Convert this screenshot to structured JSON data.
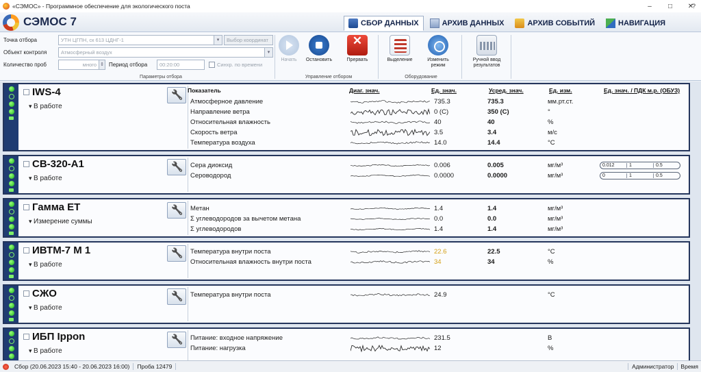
{
  "window": {
    "title": "«СЭМОС» - Программное обеспечение для экологического поста",
    "minimize": "–",
    "maximize": "□",
    "close": "✕"
  },
  "header": {
    "app_name": "СЭМОС 7",
    "tabs": [
      {
        "label": "СБОР ДАННЫХ",
        "icon": "collect-icon",
        "active": true
      },
      {
        "label": "АРХИВ ДАННЫХ",
        "icon": "archive-icon",
        "active": false
      },
      {
        "label": "АРХИВ СОБЫТИЙ",
        "icon": "events-icon",
        "active": false
      },
      {
        "label": "НАВИГАЦИЯ",
        "icon": "navigation-icon",
        "active": false
      }
    ],
    "help": "?"
  },
  "ribbon": {
    "sampling_point_label": "Точка отбора",
    "sampling_point_value": "УТН ЦГПН, ск 613 ЦДНГ-1",
    "select_coords_label": "Выбор координат",
    "control_object_label": "Объект контроля",
    "control_object_value": "Атмосферный воздух",
    "sample_count_label": "Количество проб",
    "sample_count_value": "много",
    "period_label": "Период отбора",
    "period_value": "00:20:00",
    "sync_time_label": "Синхр. по времени",
    "group_params": "Параметры отбора",
    "start_label": "Начать",
    "stop_label": "Остановить",
    "abort_label": "Прервать",
    "group_control": "Управление отбором",
    "select_label": "Выделение",
    "change_mode_label": "Изменить режим",
    "group_equipment": "Оборудование",
    "manual_input_label": "Ручной ввод результатов"
  },
  "columns": {
    "param": "Показатель",
    "diag": "Диаг. знач.",
    "value": "Ед. знач.",
    "avg": "Усред. знач.",
    "unit": "Ед. изм.",
    "pdk": "Ед. знач. / ПДК м.р. (ОБУЗ)"
  },
  "devices": [
    {
      "name": "IWS-4",
      "status": "В работе",
      "params": [
        {
          "name": "Атмосферное давление",
          "value": "735.3",
          "avg": "735.3",
          "unit": "мм.рт.ст."
        },
        {
          "name": "Направление ветра",
          "value": "0 (С)",
          "avg": "350 (С)",
          "unit": "°"
        },
        {
          "name": "Относительная влажность",
          "value": "40",
          "avg": "40",
          "unit": "%"
        },
        {
          "name": "Скорость ветра",
          "value": "3.5",
          "avg": "3.4",
          "unit": "м/с"
        },
        {
          "name": "Температура воздуха",
          "value": "14.0",
          "avg": "14.4",
          "unit": "°С"
        }
      ]
    },
    {
      "name": "СВ-320-А1",
      "status": "В работе",
      "params": [
        {
          "name": "Сера диоксид",
          "value": "0.006",
          "avg": "0.005",
          "unit": "мг/м³",
          "pdk": [
            "0.012",
            "1",
            "0.5"
          ]
        },
        {
          "name": "Сероводород",
          "value": "0.0000",
          "avg": "0.0000",
          "unit": "мг/м³",
          "pdk": [
            "0",
            "1",
            "0.5"
          ]
        }
      ]
    },
    {
      "name": "Гамма ЕТ",
      "status": "Измерение суммы",
      "params": [
        {
          "name": "Метан",
          "value": "1.4",
          "avg": "1.4",
          "unit": "мг/м³"
        },
        {
          "name": "Σ углеводородов за вычетом метана",
          "value": "0.0",
          "avg": "0.0",
          "unit": "мг/м³"
        },
        {
          "name": "Σ углеводородов",
          "value": "1.4",
          "avg": "1.4",
          "unit": "мг/м³"
        }
      ]
    },
    {
      "name": "ИВТМ-7 М 1",
      "status": "В работе",
      "params": [
        {
          "name": "Температура внутри поста",
          "value": "22.6",
          "avg": "22.5",
          "unit": "°С",
          "warn": true
        },
        {
          "name": "Относительная влажность внутри поста",
          "value": "34",
          "avg": "34",
          "unit": "%",
          "warn": true
        }
      ]
    },
    {
      "name": "СЖО",
      "status": "В работе",
      "params": [
        {
          "name": "Температура внутри поста",
          "value": "24.9",
          "avg": "",
          "unit": "°С"
        }
      ]
    },
    {
      "name": "ИБП Ippon",
      "status": "В работе",
      "params": [
        {
          "name": "Питание: входное напряжение",
          "value": "231.5",
          "avg": "",
          "unit": "В"
        },
        {
          "name": "Питание: нагрузка",
          "value": "12",
          "avg": "",
          "unit": "%"
        }
      ]
    }
  ],
  "statusbar": {
    "collection": "Сбор (20.06.2023 15:40 - 20.06.2023 16:00)",
    "sample": "Проба 12479",
    "user": "Администратор",
    "time_label": "Время"
  },
  "colors": {
    "accent": "#1f3c72",
    "border": "#24355c",
    "led_on": "#18b21a",
    "warn": "#d4a017"
  }
}
